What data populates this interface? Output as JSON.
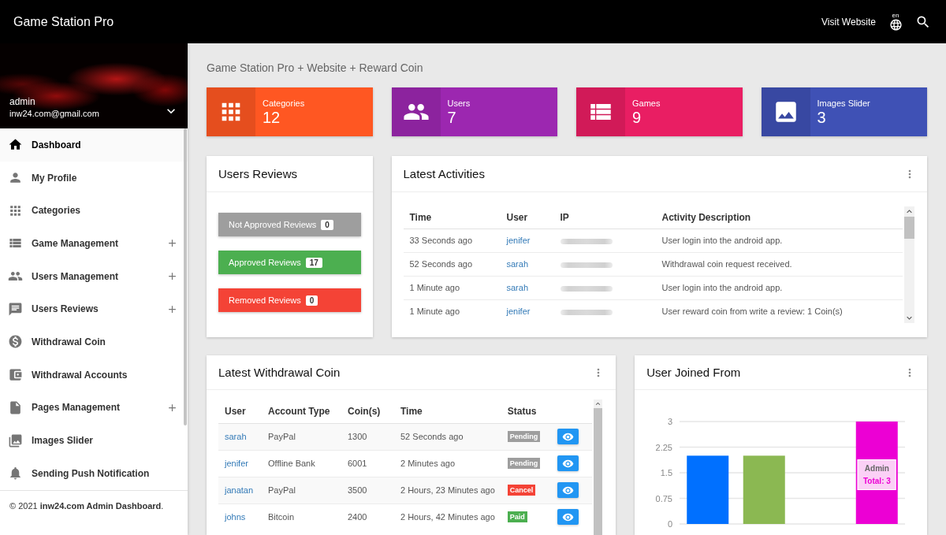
{
  "top_bar": {
    "title": "Game Station Pro",
    "link": "Visit Website",
    "language": "en"
  },
  "sidebar": {
    "user": {
      "name": "admin",
      "email": "inw24.com@gmail.com"
    },
    "items": [
      {
        "label": "Dashboard",
        "selected": true,
        "expandable": false
      },
      {
        "label": "My Profile",
        "selected": false,
        "expandable": false
      },
      {
        "label": "Categories",
        "selected": false,
        "expandable": false
      },
      {
        "label": "Game Management",
        "selected": false,
        "expandable": true
      },
      {
        "label": "Users Management",
        "selected": false,
        "expandable": true
      },
      {
        "label": "Users Reviews",
        "selected": false,
        "expandable": true
      },
      {
        "label": "Withdrawal Coin",
        "selected": false,
        "expandable": false
      },
      {
        "label": "Withdrawal Accounts",
        "selected": false,
        "expandable": false
      },
      {
        "label": "Pages Management",
        "selected": false,
        "expandable": true
      },
      {
        "label": "Images Slider",
        "selected": false,
        "expandable": false
      },
      {
        "label": "Sending Push Notification",
        "selected": false,
        "expandable": false
      }
    ],
    "footer": "© 2021 **inw24.com Admin Dashboard**."
  },
  "breadcrumb": "Game Station Pro + Website + Reward Coin",
  "stats": [
    {
      "label": "Categories",
      "value": "12",
      "color": "#ff5722"
    },
    {
      "label": "Users",
      "value": "7",
      "color": "#9c27b0"
    },
    {
      "label": "Games",
      "value": "9",
      "color": "#e91e63"
    },
    {
      "label": "Images Slider",
      "value": "3",
      "color": "#3f51b5"
    }
  ],
  "reviews": {
    "title": "Users Reviews",
    "buttons": [
      {
        "label": "Not Approved Reviews",
        "count": "0",
        "color": "#9e9e9e"
      },
      {
        "label": "Approved Reviews",
        "count": "17",
        "color": "#4caf50"
      },
      {
        "label": "Removed Reviews",
        "count": "0",
        "color": "#f44336"
      }
    ]
  },
  "activities": {
    "title": "Latest Activities",
    "menu_button": true,
    "columns": [
      "Time",
      "User",
      "IP",
      "Activity Description"
    ],
    "rows": [
      {
        "time": "33 Seconds ago",
        "user": "jenifer",
        "description": "User login into the android app."
      },
      {
        "time": "52 Seconds ago",
        "user": "sarah",
        "description": "Withdrawal coin request received."
      },
      {
        "time": "1 Minute ago",
        "user": "sarah",
        "description": "User login into the android app."
      },
      {
        "time": "1 Minute ago",
        "user": "jenifer",
        "description": "User reward coin from write a review: 1 Coin(s)"
      }
    ]
  },
  "withdrawals": {
    "title": "Latest Withdrawal Coin",
    "menu_button": true,
    "columns": [
      "User",
      "Account Type",
      "Coin(s)",
      "Time",
      "Status"
    ],
    "rows": [
      {
        "user": "sarah",
        "account_type": "PayPal",
        "coins": "1300",
        "time": "52 Seconds ago",
        "status": "Pending",
        "kind": "pending"
      },
      {
        "user": "jenifer",
        "account_type": "Offline Bank",
        "coins": "6001",
        "time": "2 Minutes ago",
        "status": "Pending",
        "kind": "pending"
      },
      {
        "user": "janatan",
        "account_type": "PayPal",
        "coins": "3500",
        "time": "2 Hours, 23 Minutes ago",
        "status": "Cancel",
        "kind": "cancel"
      },
      {
        "user": "johns",
        "account_type": "Bitcoin",
        "coins": "2400",
        "time": "2 Hours, 42 Minutes ago",
        "status": "Paid",
        "kind": "paid"
      }
    ]
  },
  "user_joined": {
    "title": "User Joined From",
    "menu_button": true,
    "tooltip": {
      "label": "Admin",
      "value": "Total: 3"
    },
    "chart_data": {
      "type": "bar",
      "values": [
        2,
        2,
        0,
        3
      ],
      "colors": [
        "#0070ff",
        "#8bb852",
        null,
        "#ec00d4"
      ],
      "ylim": [
        0,
        3
      ],
      "yticks": [
        0,
        0.75,
        1.5,
        2.25,
        3
      ],
      "grid": true
    }
  }
}
